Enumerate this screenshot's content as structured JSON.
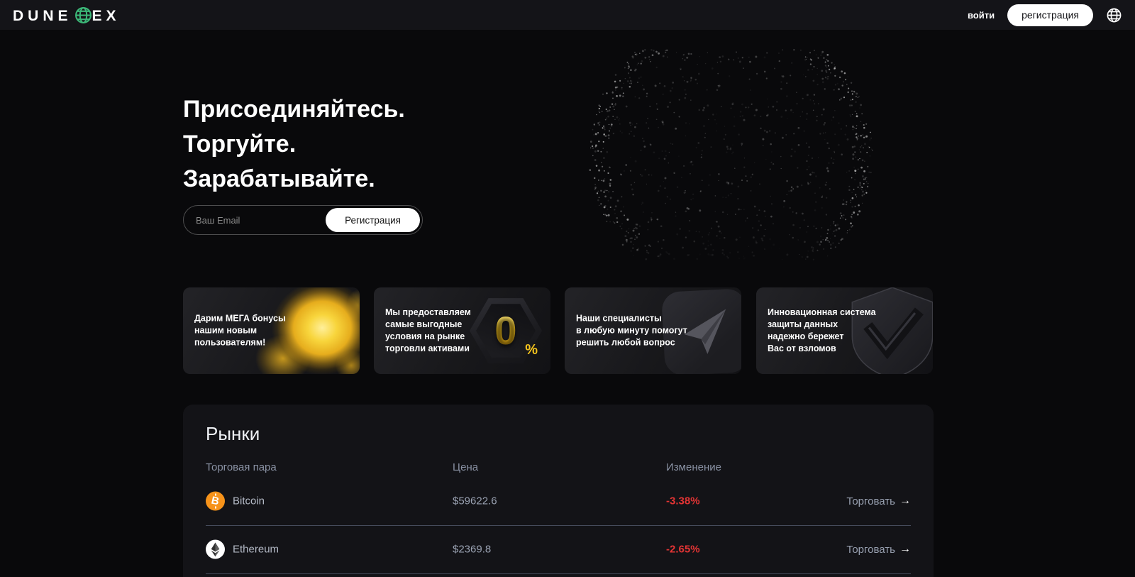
{
  "nav": {
    "logo_part1": "DUNE",
    "logo_part2": "EX",
    "login_label": "войти",
    "register_label": "регистрация"
  },
  "hero": {
    "title_lines": [
      "Присоединяйтесь.",
      "Торгуйте.",
      "Зарабатывайте."
    ],
    "email_placeholder": "Ваш Email",
    "register_button": "Регистрация"
  },
  "features": [
    {
      "icon": "yellow-explosion-image",
      "text": "Дарим МЕГА бонусы\nнашим новым\nпользователям!"
    },
    {
      "icon": "zero-percent-hexagon-icon",
      "text": "Мы предоставляем\nсамые выгодные\nусловия на рынке\nторговли активами",
      "zero": "0",
      "percent": "%"
    },
    {
      "icon": "paper-plane-icon",
      "text": "Наши специалисты\nв любую минуту помогут\nрешить любой вопрос"
    },
    {
      "icon": "shield-check-icon",
      "text": "Инновационная система\nзащиты данных\nнадежно бережет\nВас от взломов"
    }
  ],
  "markets": {
    "title": "Рынки",
    "columns": [
      "Торговая пара",
      "Цена",
      "Изменение"
    ],
    "trade_label": "Торговать",
    "trade_arrow": "→",
    "rows": [
      {
        "name": "Bitcoin",
        "price": "$59622.6",
        "change": "-3.38%"
      },
      {
        "name": "Ethereum",
        "price": "$2369.8",
        "change": "-2.65%"
      }
    ]
  },
  "colors": {
    "accent_green": "#3CB878",
    "bitcoin_orange": "#F7931A",
    "negative_red": "#E23434",
    "zero_percent_yellow": "#F4C41D",
    "page_background": "#09090B",
    "panel_background": "#131317"
  }
}
